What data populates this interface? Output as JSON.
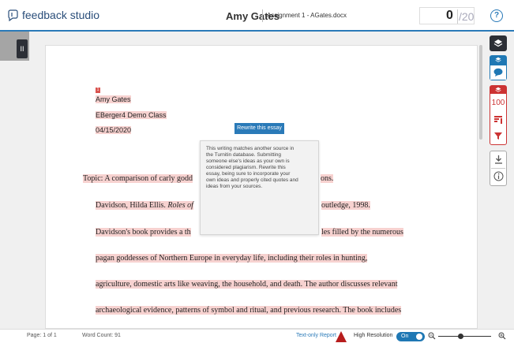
{
  "header": {
    "logo_text": "feedback studio",
    "student_name": "Amy Gates",
    "assignment": "Assignment 1 - AGates.docx",
    "score": "0",
    "score_max": "/20",
    "help_glyph": "?"
  },
  "left_toggle_glyph": "II",
  "document": {
    "marker": "1",
    "name": "Amy Gates",
    "class": "EBerger4 Demo Class",
    "date": "04/15/2020",
    "topic_a": "Topic: A comparison of carly godd",
    "topic_b": "ons.",
    "biblio_a": "Davidson, Hilda Ellis. ",
    "biblio_italic": "Roles of",
    "biblio_b": "outledge, 1998.",
    "p1_a": "Davidson's book provides a th",
    "p1_b": "les filled by the numerous",
    "p2": "pagan goddesses of Northern Europe in everyday life, including their roles in hunting,",
    "p3": "agriculture, domestic arts like weaving, the household, and death. The author discusses relevant",
    "p4": "archaeological evidence, patterns of symbol and ritual, and previous research. The book includes"
  },
  "rewrite_label": "Rewrite this essay",
  "tooltip": {
    "lines": [
      "This writing matches another source in",
      "the Turnitin database. Submitting",
      "someone else's ideas as your own is",
      "considered plagiarism. Rewrite this",
      "essay, being sure to incorporate your",
      "own ideas and properly cited quotes and",
      "ideas from your sources."
    ]
  },
  "toolbar": {
    "similarity_score": "100"
  },
  "status": {
    "page": "Page: 1 of 1",
    "word_count": "Word Count: 91",
    "text_only": "Text-only Report",
    "high_res": "High Resolution",
    "toggle_state": "On"
  },
  "colors": {
    "brand_blue": "#1f78b4",
    "match_red": "#cc3333",
    "highlight": "#f7d2d0"
  },
  "icons": [
    "feedback-studio-logo-icon",
    "help-icon",
    "layers-icon",
    "comment-bubble-icon",
    "flag-icon",
    "filter-icon",
    "download-icon",
    "info-icon",
    "zoom-out-icon",
    "zoom-in-icon"
  ]
}
